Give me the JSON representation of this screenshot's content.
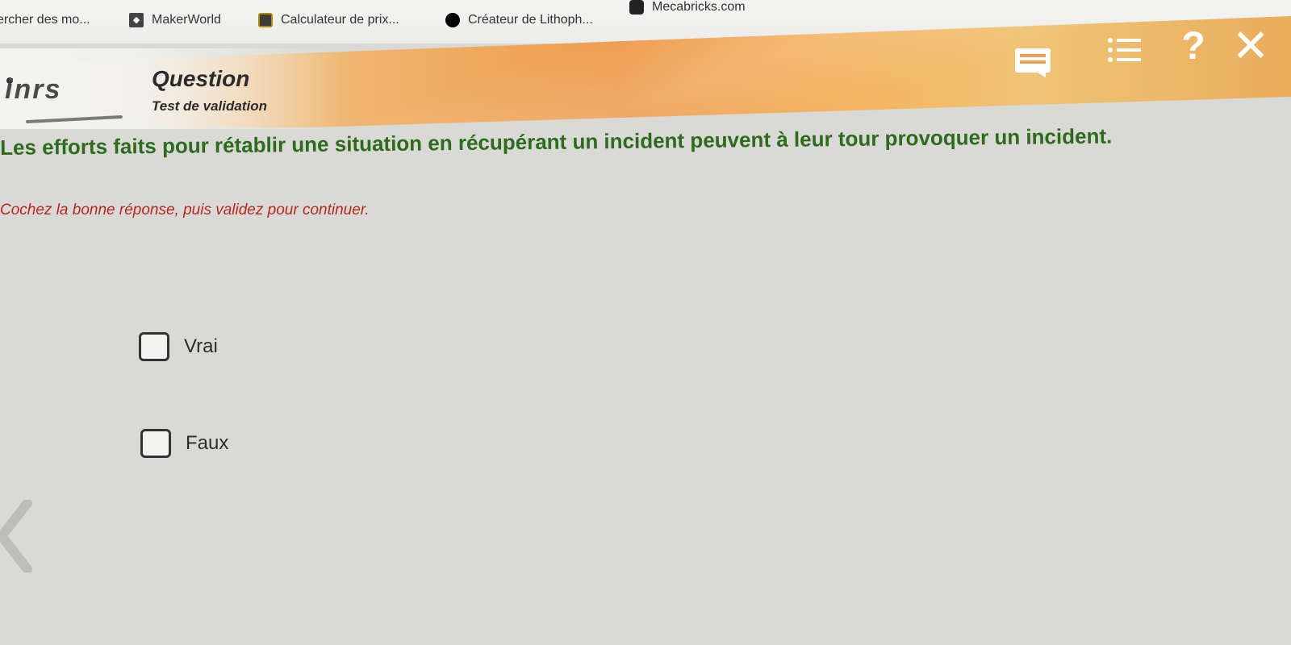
{
  "bookmarks": [
    {
      "label": "ercher des mo...",
      "icon": ""
    },
    {
      "label": "MakerWorld",
      "icon": "makerworld-icon"
    },
    {
      "label": "Calculateur de prix...",
      "icon": "calculator-icon"
    },
    {
      "label": "Créateur de Lithoph...",
      "icon": "lithophane-icon"
    },
    {
      "label": "Mecabricks.com",
      "icon": "mecabricks-icon"
    }
  ],
  "header": {
    "logo": "inrs",
    "title": "Question",
    "subtitle": "Test de validation"
  },
  "toolbar": {
    "help_glyph": "?",
    "close_glyph": "✕"
  },
  "question": {
    "text": "Les efforts faits pour rétablir une situation en récupérant un incident peuvent à leur tour provoquer un incident.",
    "instruction": "Cochez la bonne réponse, puis validez pour continuer."
  },
  "options": [
    {
      "label": "Vrai",
      "checked": false
    },
    {
      "label": "Faux",
      "checked": false
    }
  ],
  "colors": {
    "question_text": "#2e6b1f",
    "instruction_text": "#b5281f",
    "header_accent": "#ee9c4e"
  }
}
